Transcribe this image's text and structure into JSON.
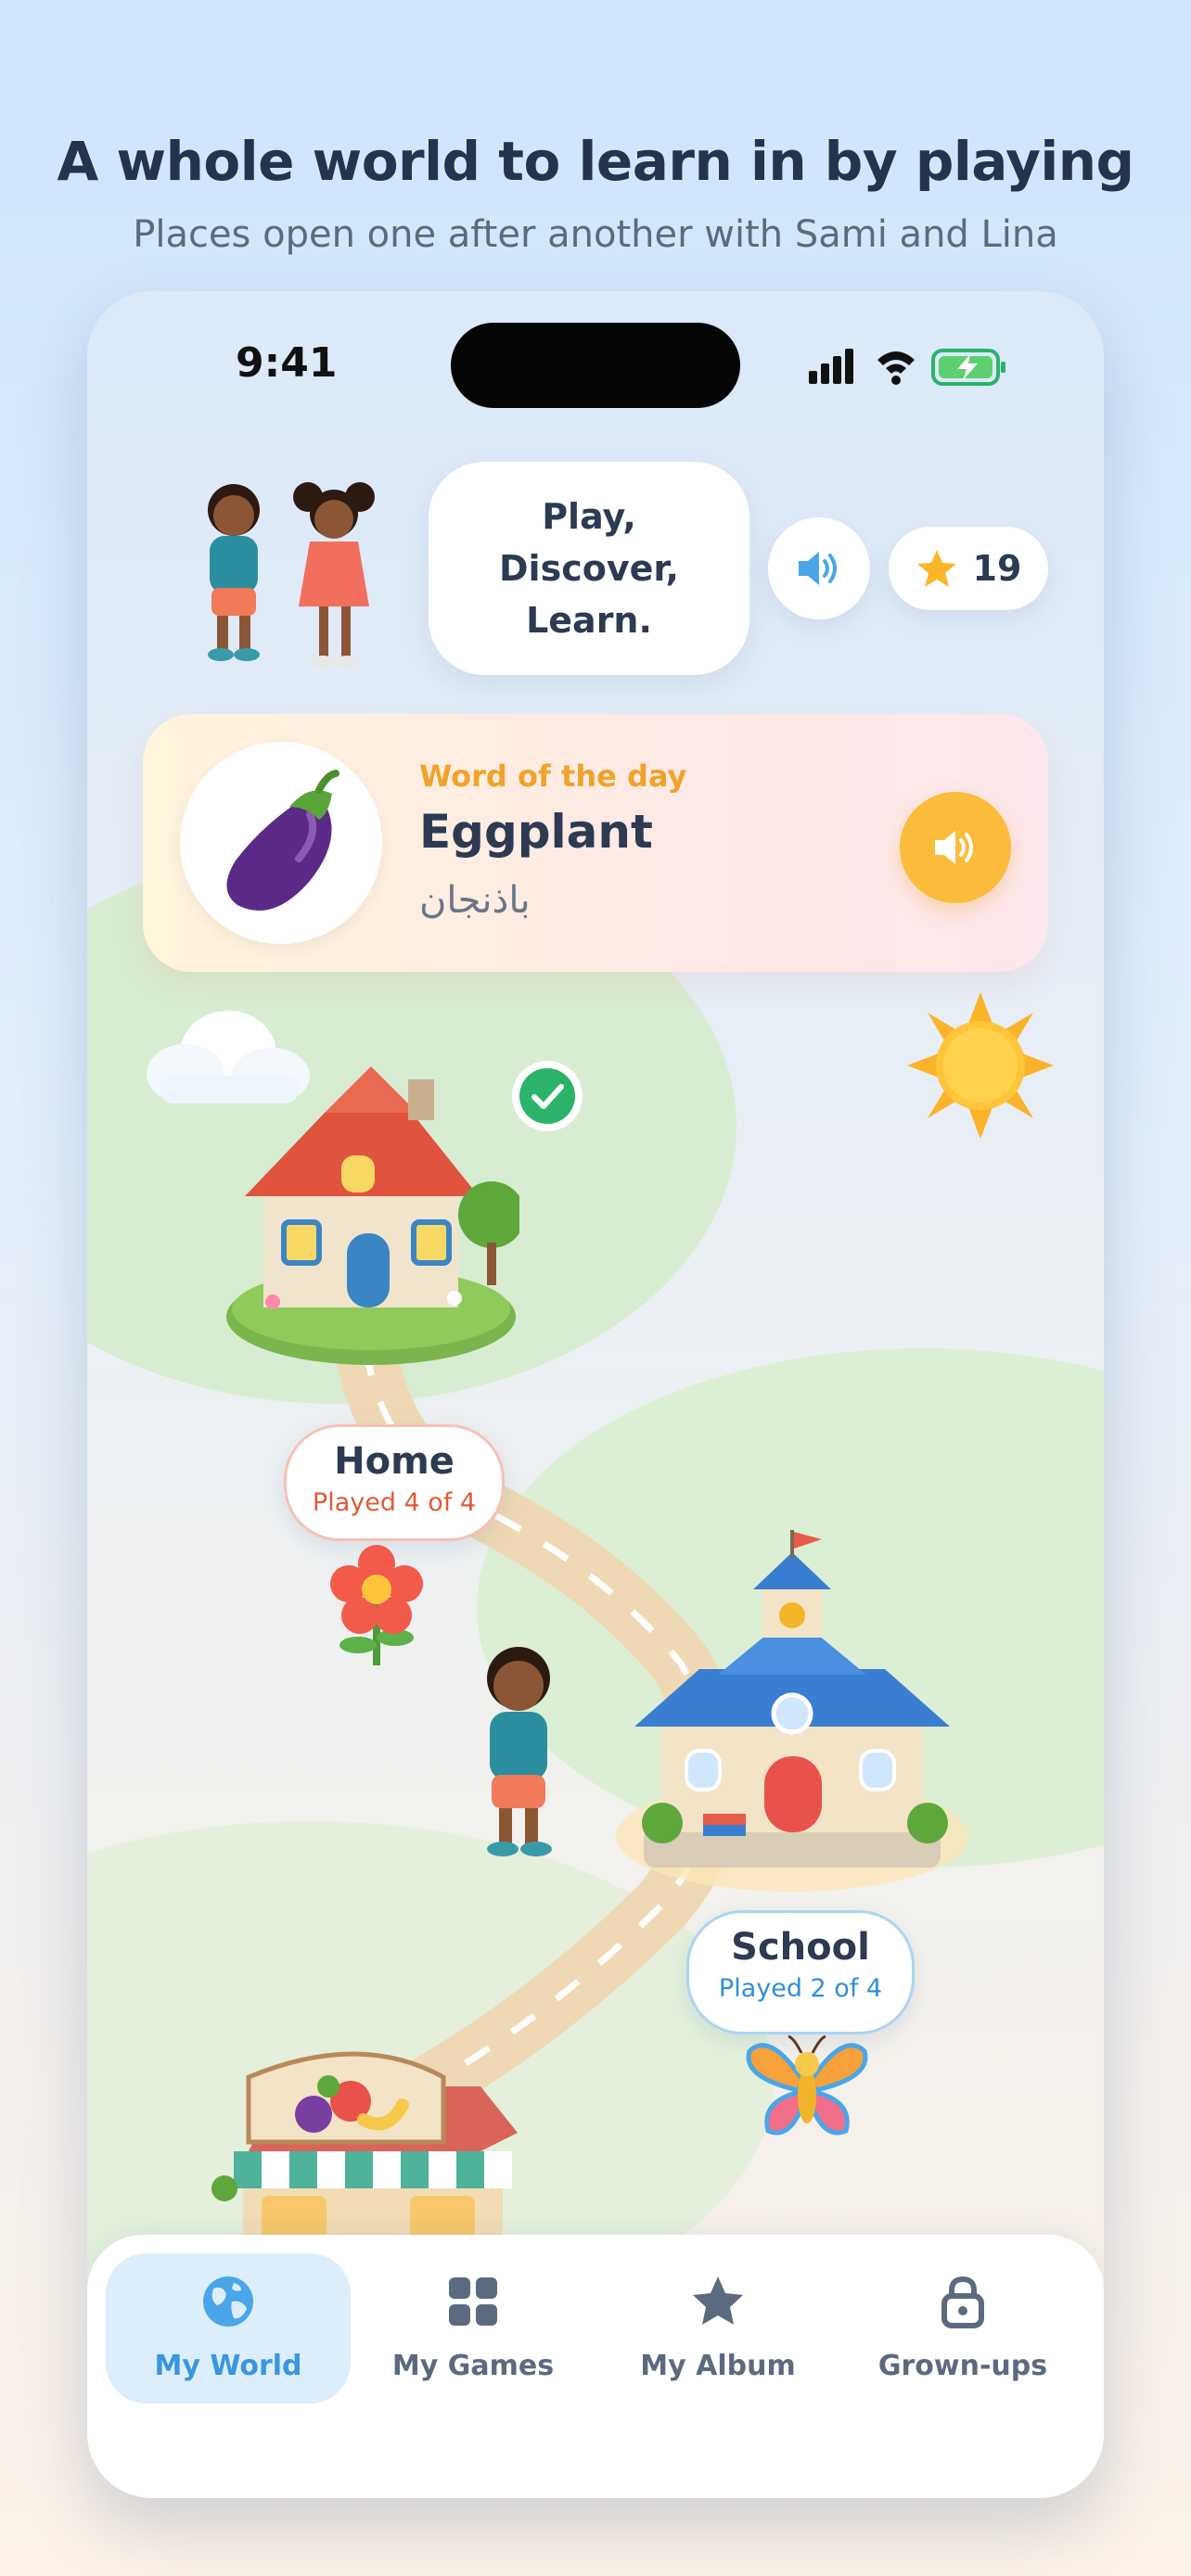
{
  "headline": "A whole world to learn in by playing",
  "subline": "Places open one after another with Sami and Lina",
  "status_bar": {
    "time": "9:41",
    "icons": [
      "cellular-signal-icon",
      "wifi-icon",
      "battery-charging-icon"
    ]
  },
  "header": {
    "mascots": [
      "boy-mascot",
      "girl-mascot"
    ],
    "speech_bubble": "Play,\nDiscover,\nLearn.",
    "sound_icon": "speaker-icon",
    "stars": {
      "icon": "star-icon",
      "count": "19"
    }
  },
  "word_of_day": {
    "label": "Word of the day",
    "word": "Eggplant",
    "word_translation": "باذنجان",
    "image": "eggplant-icon",
    "sound_icon": "speaker-icon"
  },
  "map": {
    "places": [
      {
        "name": "Home",
        "status": "Played 4 of 4",
        "completed": true,
        "status_color": "#e05a3a"
      },
      {
        "name": "School",
        "status": "Played 2 of 4",
        "completed": false,
        "status_color": "#2f8fd6"
      },
      {
        "name": "",
        "status": "",
        "image": "fruit-shop-icon"
      }
    ],
    "decorations": [
      "cloud-icon",
      "sun-icon",
      "flower-icon",
      "butterfly-icon",
      "boy-mascot"
    ]
  },
  "nav": {
    "items": [
      {
        "label": "My World",
        "icon": "globe-icon",
        "active": true
      },
      {
        "label": "My Games",
        "icon": "grid-icon",
        "active": false
      },
      {
        "label": "My Album",
        "icon": "star-icon",
        "active": false
      },
      {
        "label": "Grown-ups",
        "icon": "lock-icon",
        "active": false
      }
    ]
  },
  "colors": {
    "accent_blue": "#4aa6e8",
    "accent_orange": "#fbbb3b",
    "text_dark": "#2c3a52",
    "success_green": "#2bb36a",
    "nav_inactive": "#5c6a80"
  }
}
